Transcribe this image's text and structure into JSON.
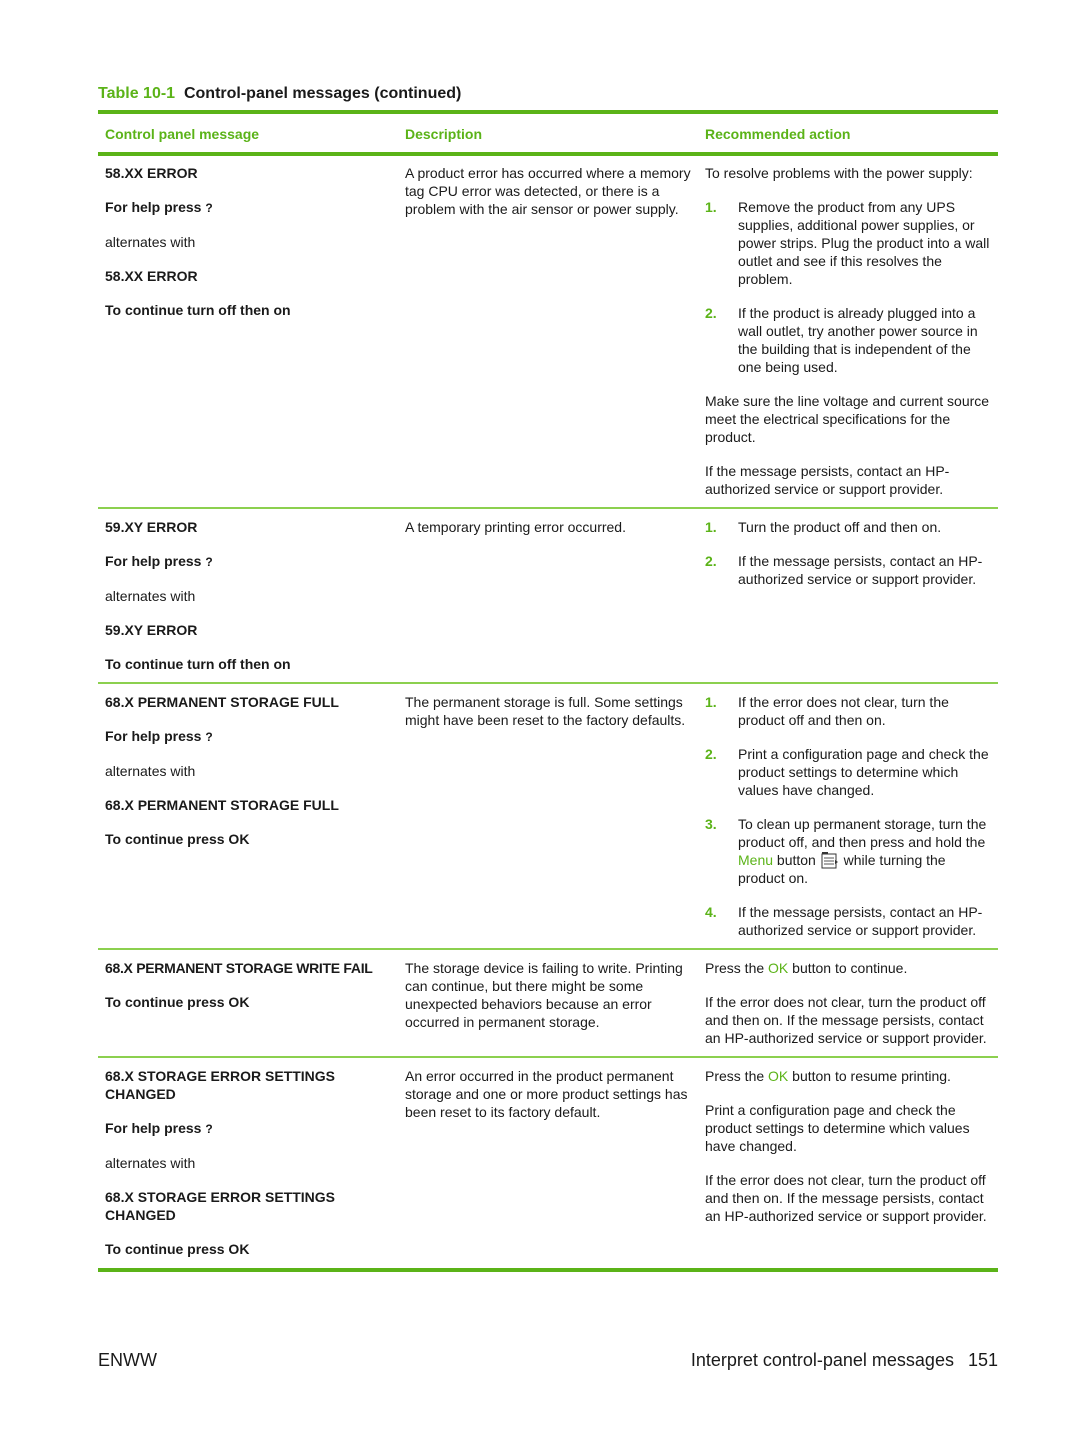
{
  "caption": {
    "table_number": "Table 10-1",
    "title": "Control-panel messages (continued)"
  },
  "columns": [
    "Control panel message",
    "Description",
    "Recommended action"
  ],
  "rows": [
    {
      "message": {
        "l1": "58.XX ERROR",
        "l2": "For help press",
        "l2q": "?",
        "l3": "alternates with",
        "l4": "58.XX ERROR",
        "l5": "To continue turn off then on"
      },
      "description": "A product error has occurred where a memory tag CPU error was detected, or there is a problem with the air sensor or power supply.",
      "action": {
        "intro": "To resolve problems with the power supply:",
        "steps": [
          {
            "num": "1.",
            "text": "Remove the product from any UPS supplies, additional power supplies, or power strips. Plug the product into a wall outlet and see if this resolves the problem."
          },
          {
            "num": "2.",
            "text": "If the product is already plugged into a wall outlet, try another power source in the building that is independent of the one being used."
          }
        ],
        "p2": "Make sure the line voltage and current source meet the electrical specifications for the product.",
        "p3": "If the message persists, contact an HP-authorized service or support provider."
      }
    },
    {
      "message": {
        "l1": "59.XY ERROR",
        "l2": "For help press",
        "l2q": "?",
        "l3": "alternates with",
        "l4": "59.XY ERROR",
        "l5": "To continue turn off then on"
      },
      "description": "A temporary printing error occurred.",
      "action": {
        "steps": [
          {
            "num": "1.",
            "text": "Turn the product off and then on."
          },
          {
            "num": "2.",
            "text": "If the message persists, contact an HP-authorized service or support provider."
          }
        ]
      }
    },
    {
      "message": {
        "l1": "68.X PERMANENT STORAGE FULL",
        "l2": "For help press",
        "l2q": "?",
        "l3": "alternates with",
        "l4": "68.X PERMANENT STORAGE FULL",
        "l5": "To continue press OK"
      },
      "description": "The permanent storage is full. Some settings might have been reset to the factory defaults.",
      "action": {
        "steps": [
          {
            "num": "1.",
            "text": "If the error does not clear, turn the product off and then on."
          },
          {
            "num": "2.",
            "text": "Print a configuration page and check the product settings to determine which values have changed."
          },
          {
            "num": "3.",
            "text_a": "To clean up permanent storage, turn the product off, and then press and hold the",
            "link": "Menu",
            "text_b": "button",
            "text_c": "while turning the product on.",
            "icon": "menu-button-icon"
          },
          {
            "num": "4.",
            "text": "If the message persists, contact an HP-authorized service or support provider."
          }
        ]
      }
    },
    {
      "message": {
        "l1": "68.X PERMANENT STORAGE WRITE FAIL",
        "l2": "To continue press OK"
      },
      "description": "The storage device is failing to write. Printing can continue, but there might be some unexpected behaviors because an error occurred in permanent storage.",
      "action": {
        "p1_a": "Press the",
        "p1_link": "OK",
        "p1_b": "button to continue.",
        "p2": "If the error does not clear, turn the product off and then on. If the message persists, contact an HP-authorized service or support provider."
      }
    },
    {
      "message": {
        "l1": "68.X STORAGE ERROR SETTINGS CHANGED",
        "l2": "For help press",
        "l2q": "?",
        "l3": "alternates with",
        "l4": "68.X STORAGE ERROR SETTINGS CHANGED",
        "l5": "To continue press OK"
      },
      "description": "An error occurred in the product permanent storage and one or more product settings has been reset to its factory default.",
      "action": {
        "p1_a": "Press the",
        "p1_link": "OK",
        "p1_b": "button to resume printing.",
        "p2": "Print a configuration page and check the product settings to determine which values have changed.",
        "p3": "If the error does not clear, turn the product off and then on. If the message persists, contact an HP-authorized service or support provider."
      }
    }
  ],
  "footer": {
    "left": "ENWW",
    "section": "Interpret control-panel messages",
    "page": "151"
  },
  "colors": {
    "accent": "#5bb318",
    "rule_thin": "#8cd04f",
    "text": "#1a1a1a"
  }
}
